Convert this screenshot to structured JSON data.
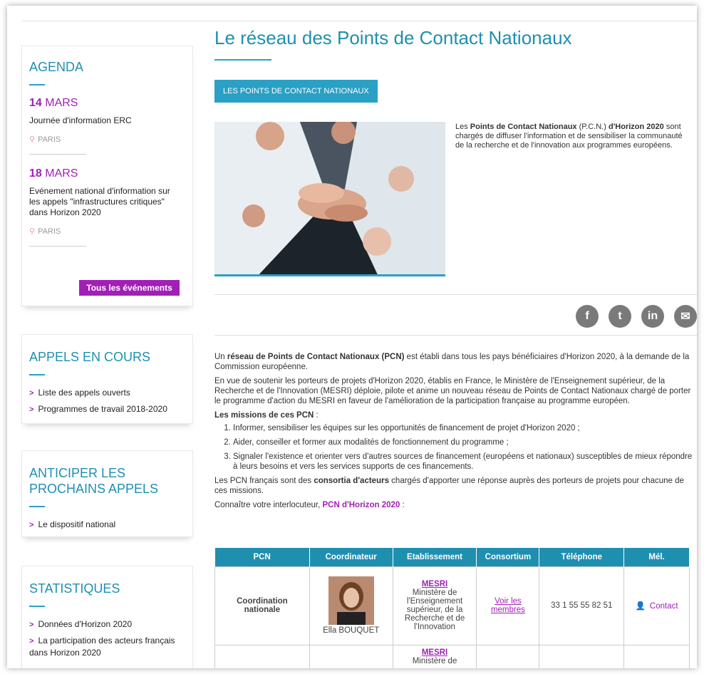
{
  "sidebar": {
    "agenda": {
      "title": "AGENDA",
      "events": [
        {
          "day": "14",
          "month": "MARS",
          "title": "Journée d'information ERC",
          "place": "PARIS"
        },
        {
          "day": "18",
          "month": "MARS",
          "title": "Evénement national d'information sur les appels \"infrastructures critiques\" dans Horizon 2020",
          "place": "PARIS"
        }
      ],
      "button": "Tous les événements"
    },
    "appels": {
      "title": "APPELS EN COURS",
      "links": [
        "Liste des appels ouverts",
        "Programmes de travail 2018-2020"
      ]
    },
    "anticiper": {
      "title": "ANTICIPER LES PROCHAINS APPELS",
      "links": [
        "Le dispositif national"
      ]
    },
    "statistiques": {
      "title": "STATISTIQUES",
      "links": [
        "Données d'Horizon 2020",
        "La participation des acteurs français dans Horizon 2020"
      ]
    }
  },
  "main": {
    "title": "Le réseau des Points de Contact Nationaux",
    "tab": "LES POINTS DE CONTACT NATIONAUX",
    "intro": {
      "pre": "Les ",
      "bold1": "Points de Contact Nationaux",
      "mid": " (P.C.N.) ",
      "bold2": "d'Horizon 2020",
      "post": " sont chargés de diffuser l'information et de sensibiliser la communauté de la recherche et de l'innovation aux programmes européens."
    },
    "social": {
      "facebook": "f",
      "twitter": "t",
      "linkedin": "in",
      "email": "✉"
    },
    "p1": {
      "pre": "Un ",
      "bold": "réseau de Points de Contact Nationaux (PCN)",
      "post": " est établi dans tous les pays bénéficiaires d'Horizon 2020, à la demande de la Commission européenne."
    },
    "p2": "En vue de soutenir les porteurs de projets d'Horizon 2020, établis en France, le Ministère de l'Enseignement supérieur, de la Recherche et de l'Innovation (MESRI) déploie, pilote et anime un nouveau réseau de Points de Contact Nationaux chargé de porter le programme d'action du MESRI en faveur de l'amélioration de la participation française au programme européen.",
    "missions_title": "Les missions de ces PCN",
    "missions": [
      "Informer, sensibiliser les équipes sur les opportunités de financement de projet d'Horizon 2020 ;",
      "Aider, conseiller et former aux modalités de fonctionnement du programme ;",
      "Signaler l'existence et orienter vers d'autres sources de financement  (européens et nationaux) susceptibles de mieux répondre à leurs besoins et vers les services supports de ces financements."
    ],
    "p3": {
      "pre": "Les PCN français sont des ",
      "bold": "consortia d'acteurs",
      "post": " chargés d'apporter une réponse auprès des porteurs de projets pour chacune de ces missions."
    },
    "p4": {
      "pre": "Connaître votre interlocuteur, ",
      "link": "PCN d'Horizon 2020",
      "post": " :"
    },
    "table": {
      "headers": [
        "PCN",
        "Coordinateur",
        "Etablissement",
        "Consortium",
        "Téléphone",
        "Mél."
      ],
      "rows": [
        {
          "pcn": "Coordination nationale",
          "coordinator": "Ella BOUQUET",
          "etab_link": "MESRI",
          "etab_text": "Ministère de l'Enseignement supérieur, de la Recherche et de l'Innovation",
          "consortium": "Voir les membres",
          "phone": "33 1 55 55 82 51",
          "mail": "Contact"
        },
        {
          "pcn": "",
          "coordinator": "",
          "etab_link": "MESRI",
          "etab_text": "Ministère de",
          "consortium": "",
          "phone": "",
          "mail": ""
        }
      ]
    }
  }
}
